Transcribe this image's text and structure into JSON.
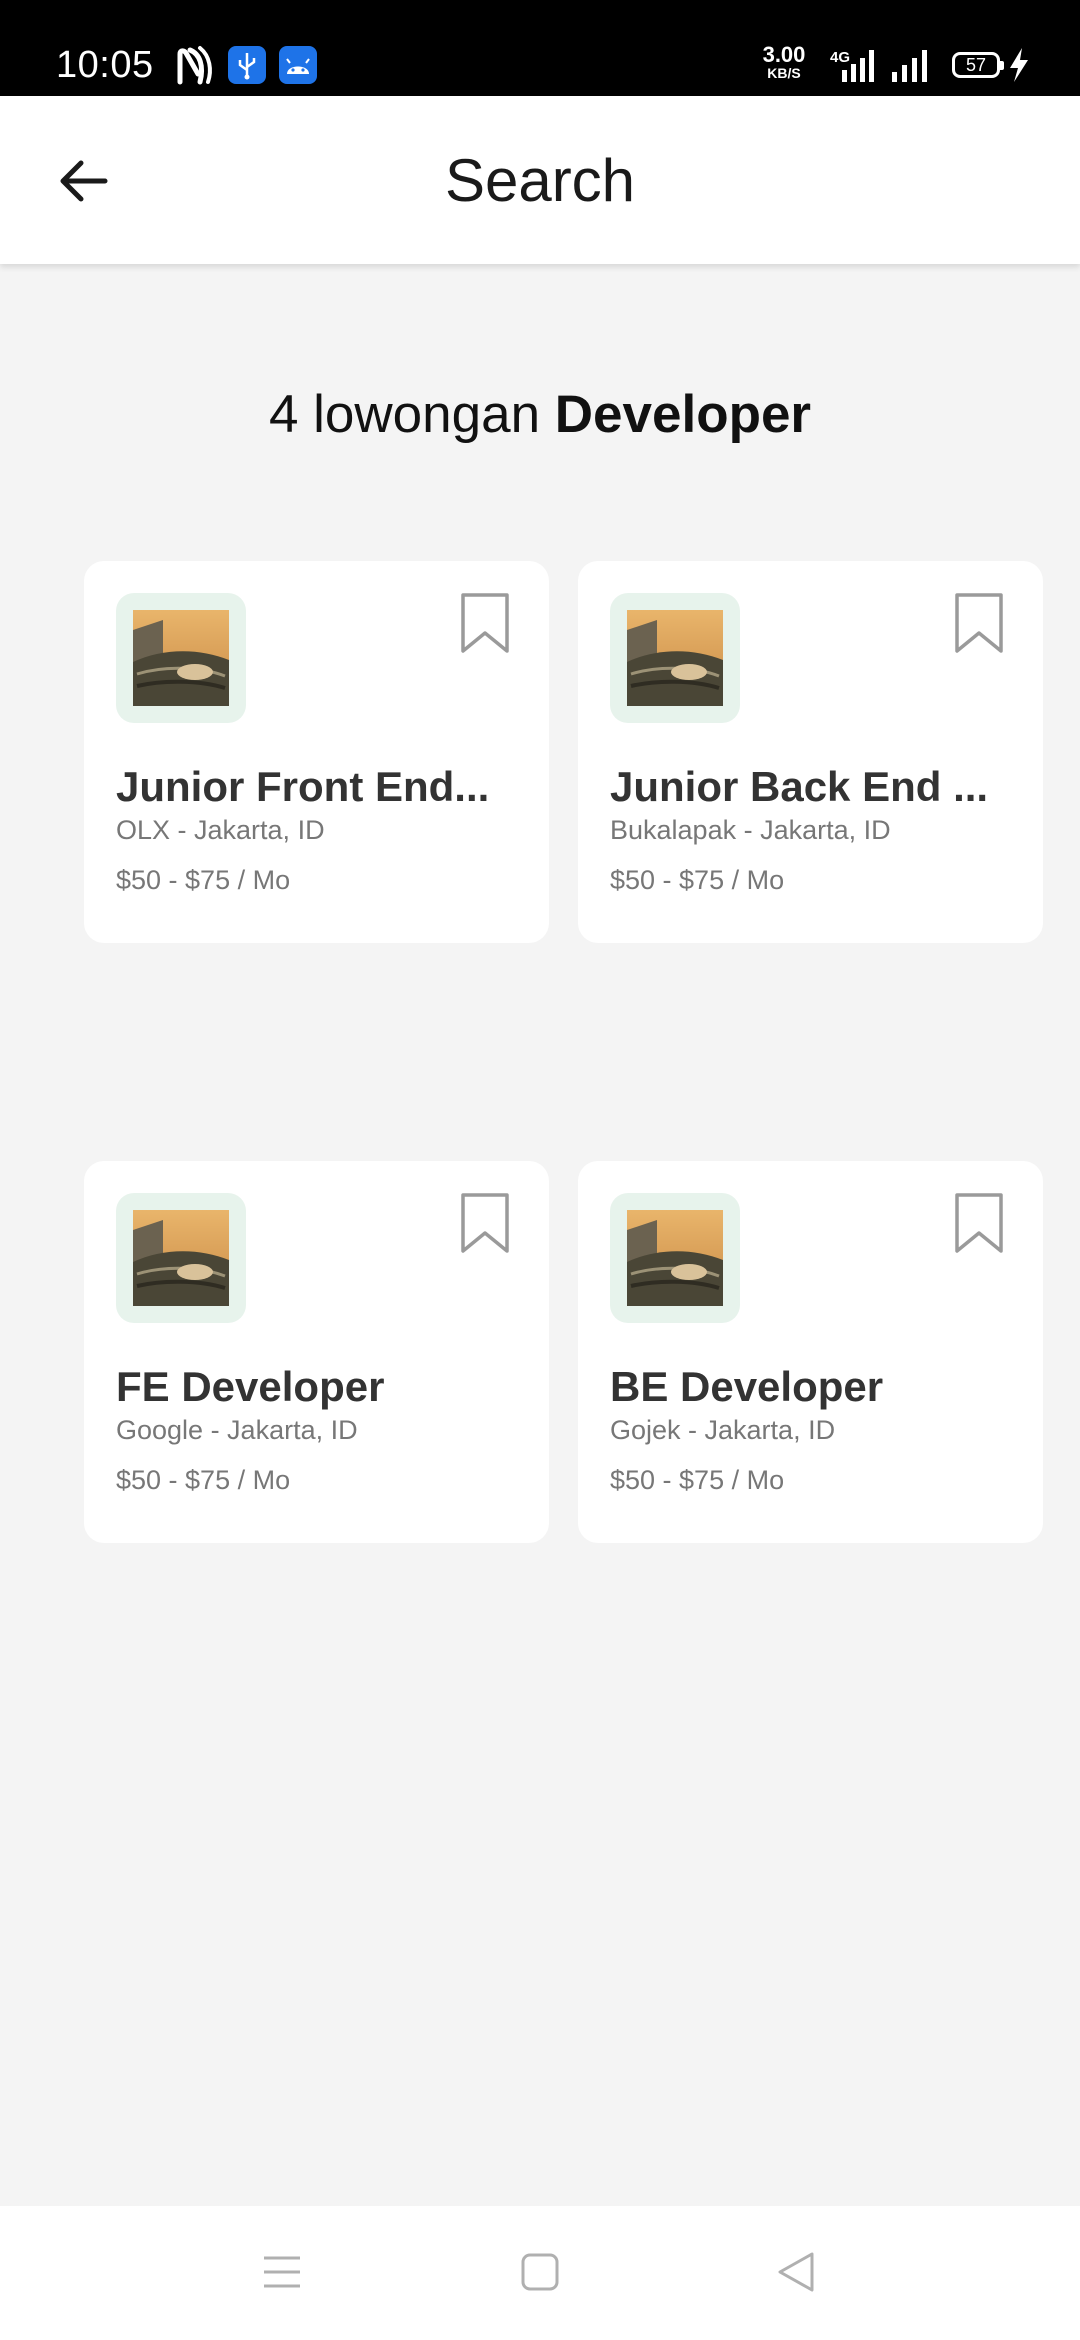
{
  "status_bar": {
    "time": "10:05",
    "speed_value": "3.00",
    "speed_unit": "KB/S",
    "network": "4G",
    "battery": "57",
    "icons": [
      "nfc-icon",
      "usb-icon",
      "android-icon",
      "signal-icon",
      "signal-icon",
      "battery-icon",
      "charging-icon"
    ]
  },
  "app_bar": {
    "title": "Search",
    "back_icon": "arrow-left-icon"
  },
  "results": {
    "count_text": "4 lowongan ",
    "keyword": "Developer"
  },
  "jobs": [
    {
      "title": "Junior Front End...",
      "company": "OLX - Jakarta, ID",
      "salary": "$50 - $75 / Mo"
    },
    {
      "title": "Junior Back End ...",
      "company": "Bukalapak - Jakarta, ID",
      "salary": "$50 - $75 / Mo"
    },
    {
      "title": "FE Developer",
      "company": "Google - Jakarta, ID",
      "salary": "$50 - $75 / Mo"
    },
    {
      "title": "BE Developer",
      "company": "Gojek - Jakarta, ID",
      "salary": "$50 - $75 / Mo"
    }
  ],
  "nav_bar": {
    "icons": [
      "menu-icon",
      "home-icon",
      "back-icon"
    ]
  },
  "colors": {
    "background": "#f4f4f4",
    "card": "#ffffff",
    "logo_bg": "#e7f3ec",
    "title_text": "#333333",
    "muted_text": "#777777"
  }
}
